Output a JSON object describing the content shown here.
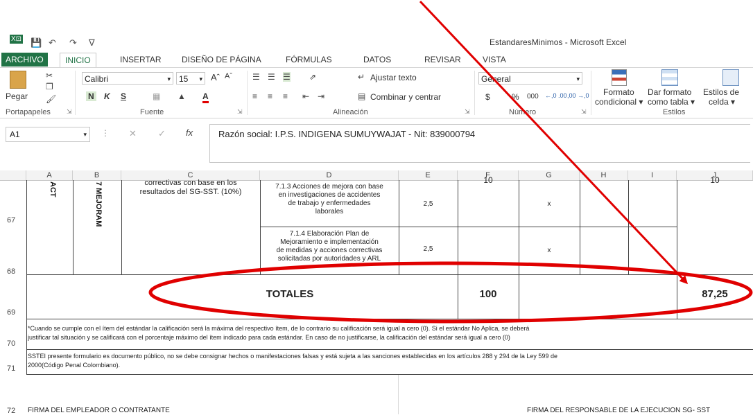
{
  "window": {
    "title": "EstandaresMinimos - Microsoft Excel",
    "app_icon": "X⊡"
  },
  "tabs": [
    "ARCHIVO",
    "INICIO",
    "INSERTAR",
    "DISEÑO DE PÁGINA",
    "FÓRMULAS",
    "DATOS",
    "REVISAR",
    "VISTA"
  ],
  "ribbon": {
    "clipboard": {
      "paste": "Pegar",
      "label": "Portapapeles"
    },
    "font": {
      "name": "Calibri",
      "size": "15",
      "bold": "N",
      "italic": "K",
      "underline": "S",
      "label": "Fuente",
      "grow": "Aˆ",
      "shrink": "Aˇ"
    },
    "alignment": {
      "wrap": "Ajustar texto",
      "merge": "Combinar y centrar",
      "label": "Alineación"
    },
    "number": {
      "format": "General",
      "currency": "$",
      "percent": "%",
      "thousands": "000",
      "dec_inc": "←,0 .00",
      "dec_dec": ",00 →,0",
      "label": "Número"
    },
    "styles": {
      "cond_format": [
        "Formato",
        "condicional ▾"
      ],
      "as_table": [
        "Dar formato",
        "como tabla ▾"
      ],
      "cell_styles": [
        "Estilos de",
        "celda ▾"
      ],
      "label": "Estilos"
    }
  },
  "formula_bar": {
    "name_box": "A1",
    "cancel": "✕",
    "enter": "✓",
    "fx": "fx",
    "value": "Razón social: I.P.S. INDIGENA SUMUYWAJAT - Nit: 839000794"
  },
  "columns": [
    "A",
    "B",
    "C",
    "D",
    "E",
    "F",
    "G",
    "H",
    "I",
    "J"
  ],
  "rows": {
    "r67": "67",
    "r68": "68",
    "r69": "69",
    "r70": "70",
    "r71": "71",
    "r72": "72"
  },
  "cells": {
    "a_rot": "ACT",
    "b_rot": "7 MEJORAM",
    "c_text": [
      "correctivas con base en los",
      "resultados del SG-SST. (10%)"
    ],
    "f_top": "10",
    "j_top": "10",
    "d67": [
      "7.1.3 Acciones de mejora con base",
      "en investigaciones de accidentes",
      "de trabajo y enfermedades",
      "laborales"
    ],
    "e67": "2,5",
    "g67": "x",
    "d68": [
      "7.1.4 Elaboración Plan de",
      "Mejoramiento e implementación",
      "de medidas y acciones correctivas",
      "solicitadas por autoridades y ARL"
    ],
    "e68": "2,5",
    "g68": "x",
    "totales": "TOTALES",
    "f69": "100",
    "j69": "87,25",
    "r70_line1": "*Cuando se cumple con el ítem del estándar la calificación será la máxima del respectivo ítem, de lo contrario su calificación será igual a cero (0). Si el estándar No Aplica, se deberá",
    "r70_line2": "justificar tal situación y se calificará con el porcentaje máximo del ítem indicado para cada estándar. En caso de no justificarse, la calificación del estándar será igual a cero (0)",
    "r71_line1": "SSTEI presente formulario es documento público, no se debe consignar hechos o manifestaciones falsas y está sujeta a las sanciones establecidas en los artículos 288 y 294 de la Ley 599 de",
    "r71_line2": "2000(Código Penal Colombiano).",
    "r72_left": "FIRMA DEL EMPLEADOR O CONTRATANTE",
    "r72_right": "FIRMA DEL RESPONSABLE  DE LA EJECUCIÓN SG- SST"
  },
  "colors": {
    "excel_green": "#217346",
    "annotation_red": "#e00000"
  }
}
